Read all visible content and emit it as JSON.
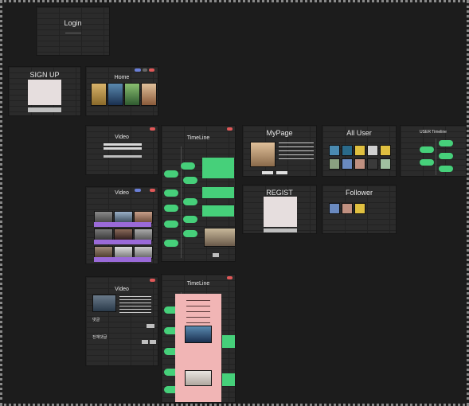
{
  "screens": {
    "login": {
      "title": "Login"
    },
    "signup": {
      "title": "SIGN UP"
    },
    "home": {
      "title": "Home"
    },
    "video": {
      "title": "Video"
    },
    "timeline": {
      "title": "TimeLine"
    },
    "mypage": {
      "title": "MyPage"
    },
    "all_user": {
      "title": "All User"
    },
    "user_timeline": {
      "title": "USER Timeline"
    },
    "regist": {
      "title": "REGIST"
    },
    "follower": {
      "title": "Follower"
    },
    "video_list": {
      "title": "Video"
    },
    "video_detail": {
      "title": "Video",
      "comment_label": "댓글",
      "more_comment_label": "전체댓글"
    },
    "timeline_detail": {
      "title": "TimeLine"
    }
  },
  "colors": {
    "accent_green": "#46d07a",
    "accent_purple": "#9a6ad8",
    "panel_pink": "#f1b5b5",
    "background": "#1c1c1c"
  }
}
